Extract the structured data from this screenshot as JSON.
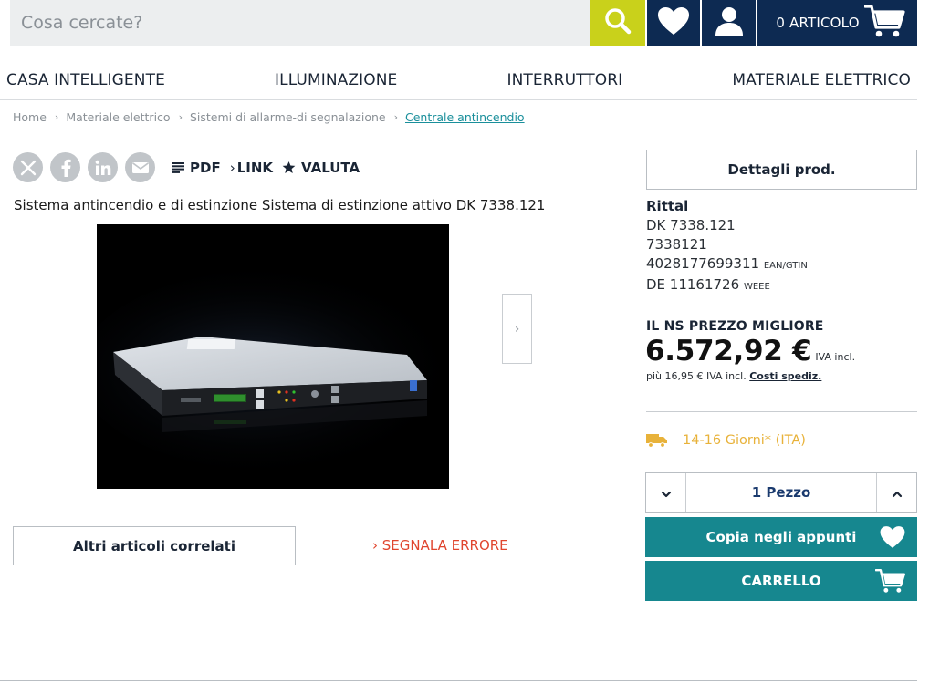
{
  "header": {
    "search_placeholder": "Cosa cercate?",
    "cart_label": "0 ARTICOLO",
    "icons": [
      "search-icon",
      "heart-icon",
      "user-icon",
      "cart-icon"
    ],
    "colors": {
      "search_button": "#c9d11b",
      "nav_button": "#0d2a52"
    }
  },
  "categories": [
    "CASA INTELLIGENTE",
    "ILLUMINAZIONE",
    "INTERRUTTORI",
    "MATERIALE ELETTRICO"
  ],
  "breadcrumb": [
    "Home",
    "Materiale elettrico",
    "Sistemi di allarme-di segnalazione",
    "Centrale antincendio"
  ],
  "share": {
    "icons": [
      "x-icon",
      "facebook-icon",
      "linkedin-icon",
      "mail-icon"
    ],
    "pdf_label": "PDF",
    "link_label": "LINK",
    "rate_label": "VALUTA"
  },
  "product": {
    "title": "Sistema antincendio e di estinzione Sistema di estinzione attivo DK 7338.121",
    "image_alt": "DET-AC III Master",
    "brand": "Rittal",
    "model": "DK 7338.121",
    "article_number": "7338121",
    "ean": "4028177699311",
    "ean_tag": "EAN/GTIN",
    "weee": "DE 11161726",
    "weee_tag": "WEEE"
  },
  "buttons": {
    "details": "Dettagli prod.",
    "related": "Altri articoli correlati",
    "report_error": "SEGNALA ERRORE",
    "clipboard": "Copia negli appunti",
    "cart": "CARRELLO"
  },
  "pricing": {
    "heading": "IL NS PREZZO MIGLIORE",
    "price": "6.572,92 €",
    "vat_label": "IVA incl.",
    "shipping_prefix": "più 16,95 € IVA incl.",
    "shipping_link": "Costi spediz."
  },
  "delivery": {
    "text": "14-16 Giorni* (ITA)",
    "color": "#e8b23a"
  },
  "quantity": {
    "value": "1 Pezzo"
  },
  "accent_colors": {
    "teal": "#16878f",
    "error": "#e0452e"
  }
}
